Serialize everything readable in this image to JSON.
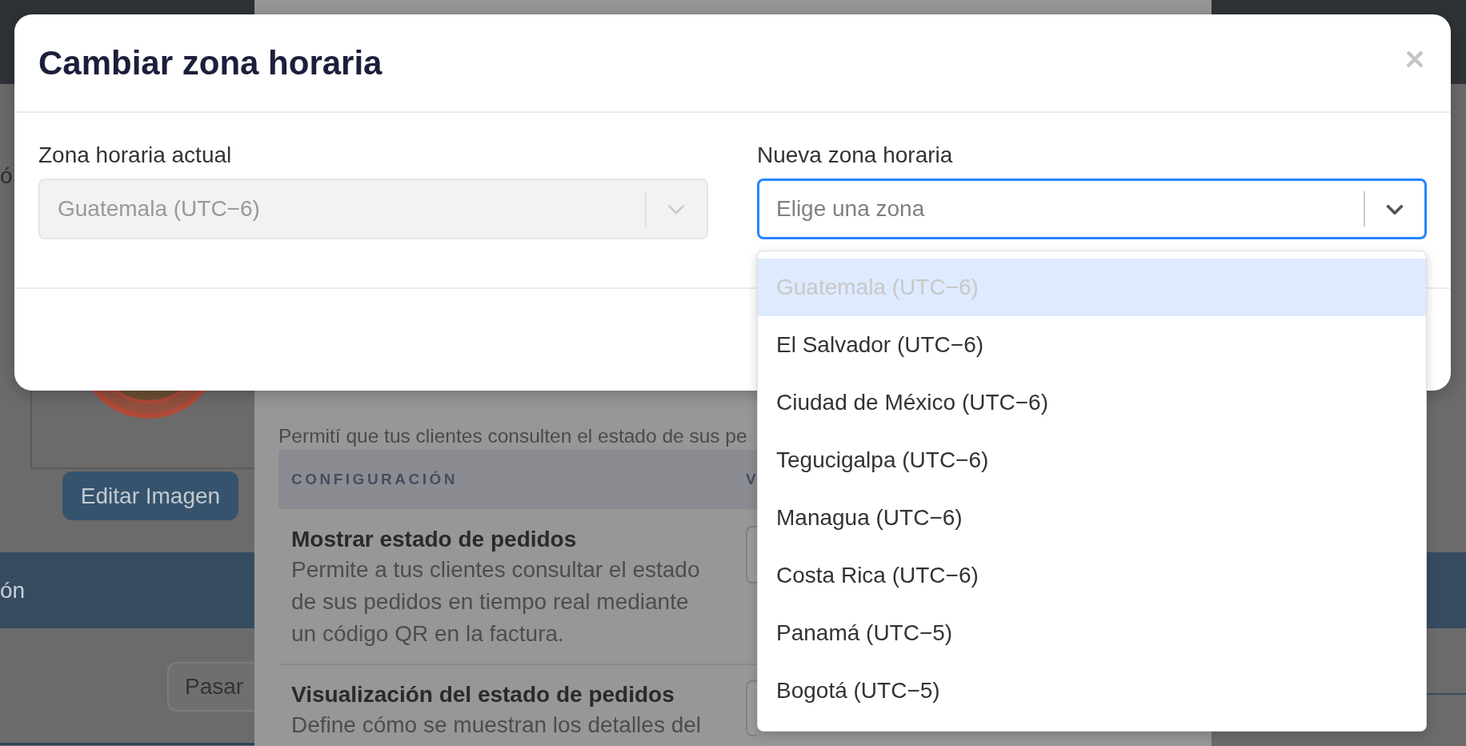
{
  "background": {
    "left_column": {
      "heading_fragment": "ó",
      "image_button": "Editar Imagen",
      "banner_fragment": "ón",
      "button_fragment": "Pasar"
    },
    "panel": {
      "intro": "Permití que tus clientes consulten el estado de sus pe",
      "table": {
        "columns": [
          "CONFIGURACIÓN",
          "V"
        ],
        "rows": [
          {
            "title": "Mostrar estado de pedidos",
            "description": "Permite a tus clientes consultar el estado de sus pedidos en tiempo real mediante un código QR en la factura."
          },
          {
            "title": "Visualización del estado de pedidos",
            "description": "Define cómo se muestran los detalles del"
          }
        ]
      }
    }
  },
  "dialog": {
    "title": "Cambiar zona horaria",
    "fields": [
      {
        "label": "Zona horaria actual",
        "value": "Guatemala (UTC−6)",
        "disabled": true,
        "focused": false
      },
      {
        "label": "Nueva zona horaria",
        "placeholder": "Elige una zona",
        "disabled": false,
        "focused": true,
        "options": [
          {
            "label": "Guatemala (UTC−6)",
            "selected": true,
            "disabled": true
          },
          {
            "label": "El Salvador (UTC−6)",
            "selected": false,
            "disabled": false
          },
          {
            "label": "Ciudad de México (UTC−6)",
            "selected": false,
            "disabled": false
          },
          {
            "label": "Tegucigalpa (UTC−6)",
            "selected": false,
            "disabled": false
          },
          {
            "label": "Managua (UTC−6)",
            "selected": false,
            "disabled": false
          },
          {
            "label": "Costa Rica (UTC−6)",
            "selected": false,
            "disabled": false
          },
          {
            "label": "Panamá (UTC−5)",
            "selected": false,
            "disabled": false
          },
          {
            "label": "Bogotá (UTC−5)",
            "selected": false,
            "disabled": false
          }
        ]
      }
    ]
  }
}
